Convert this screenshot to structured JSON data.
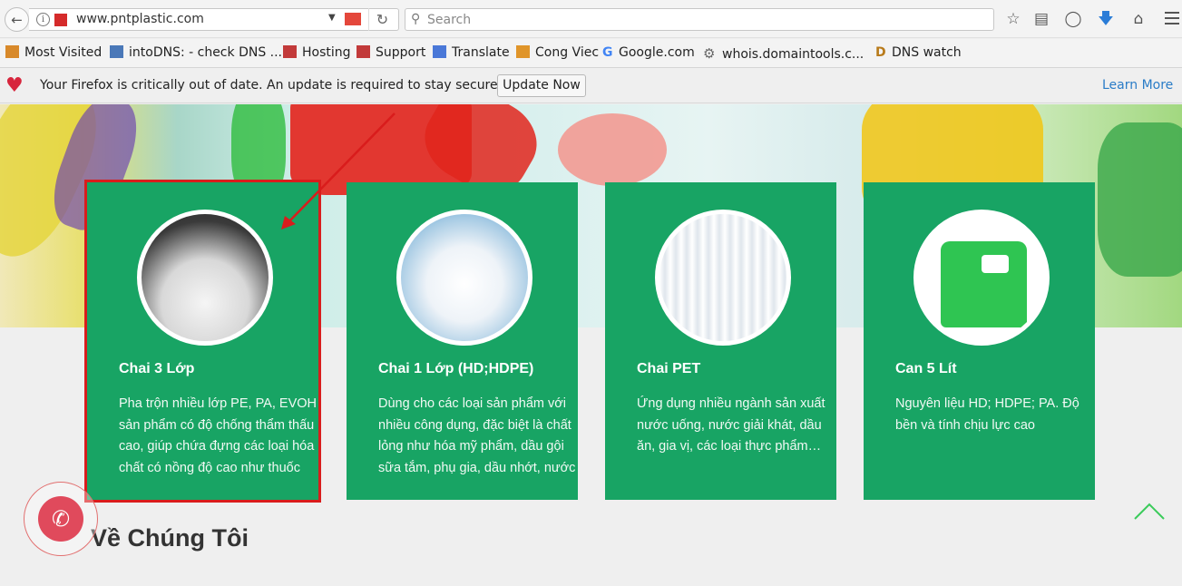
{
  "browser": {
    "url": "www.pntplastic.com",
    "search_placeholder": "Search"
  },
  "bookmarks": [
    {
      "label": "Most Visited",
      "icon": "most-visited-icon",
      "color": "#d8892a"
    },
    {
      "label": "intoDNS: - check DNS ...",
      "icon": "dns-icon",
      "color": "#4a78b8"
    },
    {
      "label": "Hosting",
      "icon": "hosting-icon",
      "color": "#c23a3a"
    },
    {
      "label": "Support",
      "icon": "support-icon",
      "color": "#c23a3a"
    },
    {
      "label": "Translate",
      "icon": "translate-icon",
      "color": "#4a78d8"
    },
    {
      "label": "Cong Viec",
      "icon": "folder-icon",
      "color": "#e0952a"
    },
    {
      "label": "Google.com",
      "icon": "google-icon",
      "color": "#4285f4"
    },
    {
      "label": "whois.domaintools.c...",
      "icon": "gear-icon",
      "color": "#666666"
    },
    {
      "label": "DNS watch",
      "icon": "dnswatch-icon",
      "color": "#b87a1a"
    }
  ],
  "notification": {
    "message": "Your Firefox is critically out of date. An update is required to stay secure.",
    "button": "Update Now",
    "link": "Learn More"
  },
  "cards": [
    {
      "title": "Chai 3 Lớp",
      "description": "Pha trộn nhiều lớp PE, PA, EVOH sản phẩm có độ chống thẩm thấu cao, giúp chứa đựng các loại hóa chất có nồng độ cao như thuốc"
    },
    {
      "title": "Chai 1 Lớp (HD;HDPE)",
      "description": "Dùng cho các loại sản phẩm với nhiều công dụng, đặc biệt là chất lỏng như hóa mỹ phẩm, dầu gội sữa tắm, phụ gia, dầu nhớt, nước"
    },
    {
      "title": "Chai PET",
      "description": "Ứng dụng nhiều ngành sản xuất nước uống, nước giải khát, dầu ăn, gia vị, các loại thực phẩm…"
    },
    {
      "title": "Can 5 Lít",
      "description": "Nguyên liệu HD; HDPE; PA. Độ bền và tính chịu lực cao"
    }
  ],
  "section_title": "Về Chúng Tôi",
  "colors": {
    "card_green": "#18a464",
    "highlight_red": "#d91c1c",
    "phone_red": "#e04a5c"
  }
}
